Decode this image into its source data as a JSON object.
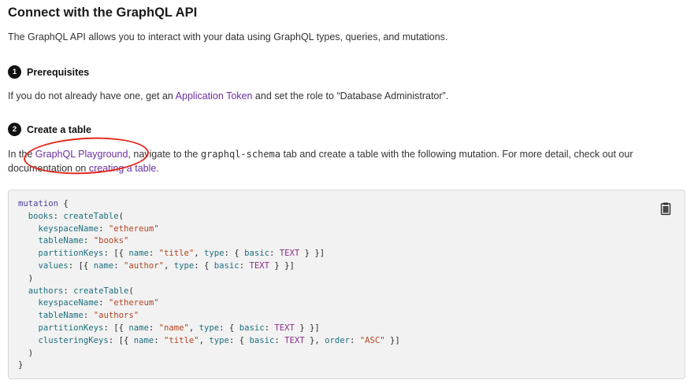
{
  "title": "Connect with the GraphQL API",
  "intro": "The GraphQL API allows you to interact with your data using GraphQL types, queries, and mutations.",
  "steps": [
    {
      "number": "1",
      "title": "Prerequisites",
      "text_before": "If you do not already have one, get an ",
      "link": "Application Token",
      "text_after": " and set the role to “Database Administrator”."
    },
    {
      "number": "2",
      "title": "Create a table",
      "text_before": "In the ",
      "link1": "GraphQL Playground",
      "text_mid1": ", navigate to the ",
      "code": "graphql-schema",
      "text_mid2": " tab and create a table with the following mutation. For more detail, check out our documentation on ",
      "link2": "creating a table",
      "text_after": "."
    }
  ],
  "icons": {
    "copy": "clipboard-icon"
  },
  "colors": {
    "link": "#6b2fa0",
    "annotation": "#e4261b",
    "code_bg": "#f2f2f2"
  },
  "code": {
    "mutation": "mutation",
    "books_alias": "books",
    "authors_alias": "authors",
    "create_fn": "createTable",
    "keyspace_key": "keyspaceName",
    "table_key": "tableName",
    "partition_key": "partitionKeys",
    "values_key": "values",
    "clustering_key": "clusteringKeys",
    "name_key": "name",
    "type_key": "type",
    "basic_key": "basic",
    "order_key": "order",
    "text_type": "TEXT",
    "keyspace_val": "\"ethereum\"",
    "books_table": "\"books\"",
    "authors_table": "\"authors\"",
    "title_col": "\"title\"",
    "author_col": "\"author\"",
    "name_col": "\"name\"",
    "asc": "\"ASC\""
  }
}
